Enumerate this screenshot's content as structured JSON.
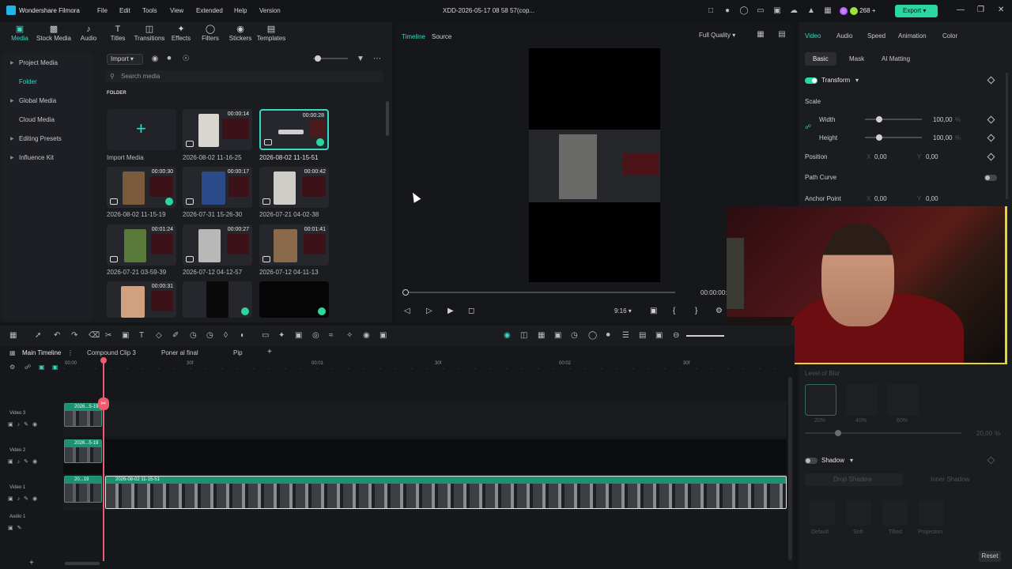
{
  "app": {
    "name": "Wondershare Filmora",
    "document_title": "XDD-2026-05-17 08 58 57(cop...",
    "menus": [
      "File",
      "Edit",
      "Tools",
      "View",
      "Extended",
      "Help",
      "Version"
    ],
    "credits": "268",
    "export_label": "Export",
    "accent_color": "#39d8c2"
  },
  "toolbar_tabs": [
    {
      "label": "Media",
      "icon": "media-icon"
    },
    {
      "label": "Stock Media",
      "icon": "stock-media-icon"
    },
    {
      "label": "Audio",
      "icon": "music-note-icon"
    },
    {
      "label": "Titles",
      "icon": "text-icon"
    },
    {
      "label": "Transitions",
      "icon": "transitions-icon"
    },
    {
      "label": "Effects",
      "icon": "sparkle-icon"
    },
    {
      "label": "Filters",
      "icon": "filters-icon"
    },
    {
      "label": "Stickers",
      "icon": "sticker-icon"
    },
    {
      "label": "Templates",
      "icon": "templates-icon"
    }
  ],
  "left_nav": {
    "items": [
      {
        "label": "Project Media",
        "caret": true
      },
      {
        "label": "Folder",
        "active": true
      },
      {
        "label": "Global Media",
        "caret": true
      },
      {
        "label": "Cloud Media"
      },
      {
        "label": "Editing Presets",
        "caret": true
      },
      {
        "label": "Influence Kit",
        "caret": true
      }
    ]
  },
  "media": {
    "import_label": "Import",
    "search_placeholder": "Search media",
    "folder_heading": "FOLDER",
    "import_tile_label": "Import Media",
    "items": [
      {
        "name": "2026-08-02 11-16-25",
        "duration": "00:00:14"
      },
      {
        "name": "2026-08-02 11-15-51",
        "duration": "00:00:28",
        "selected": true
      },
      {
        "name": "2026-08-02 11-15-19",
        "duration": "00:00:30"
      },
      {
        "name": "2026-07-31 15-26-30",
        "duration": "00:00:17"
      },
      {
        "name": "2026-07-21 04-02-38",
        "duration": "00:00:42"
      },
      {
        "name": "2026-07-21 03-59-39",
        "duration": "00:01:24"
      },
      {
        "name": "2026-07-12 04-12-57",
        "duration": "00:00:27"
      },
      {
        "name": "2026-07-12 04-11-13",
        "duration": "00:01:41"
      },
      {
        "name": "",
        "duration": "00:00:31"
      },
      {
        "name": "",
        "duration": ""
      },
      {
        "name": "",
        "duration": ""
      }
    ]
  },
  "preview": {
    "tab_timeline": "Timeline",
    "tab_source": "Source",
    "quality": "Full Quality",
    "timecode": "00:00:00:1",
    "ratio": "9:16"
  },
  "properties": {
    "tabs": [
      "Video",
      "Audio",
      "Speed",
      "Animation",
      "Color"
    ],
    "subtabs": [
      "Basic",
      "Mask",
      "AI Matting"
    ],
    "transform_label": "Transform",
    "scale_label": "Scale",
    "width_label": "Width",
    "width_value": "100,00",
    "width_unit": "%",
    "height_label": "Height",
    "height_value": "100,00",
    "height_unit": "%",
    "position_label": "Position",
    "pos_x": "0,00",
    "pos_y": "0,00",
    "path_curve_label": "Path Curve",
    "anchor_label": "Anchor Point",
    "anchor_x": "0,00",
    "anchor_y": "0,00",
    "x_label": "X",
    "y_label": "Y",
    "blur_level_label": "Level of Blur",
    "blur_presets": [
      "20%",
      "40%",
      "60%"
    ],
    "blur_value": "20,00",
    "blur_unit": "%",
    "shadow_label": "Shadow",
    "drop_shadow": "Drop Shadow",
    "inner_shadow": "Inner Shadow",
    "shadow_presets": [
      "Default",
      "Soft",
      "Tilted",
      "Projection"
    ],
    "reset_label": "Reset"
  },
  "timeline": {
    "tabs": [
      "Main Timeline",
      "Compound Clip 3",
      "Poner al final",
      "Pip"
    ],
    "ruler_labels": [
      "00:00",
      "30f",
      "00:01",
      "30f",
      "00:02",
      "30f"
    ],
    "tracks": [
      {
        "name": "Video 3",
        "clip": "2026...5-19"
      },
      {
        "name": "Video 2",
        "clip": "2026...5-19"
      },
      {
        "name": "Video 1",
        "clip": "20...19",
        "clip2": "2026-08-02 11-15-51"
      },
      {
        "name": "Audio 1",
        "clip": ""
      }
    ]
  }
}
